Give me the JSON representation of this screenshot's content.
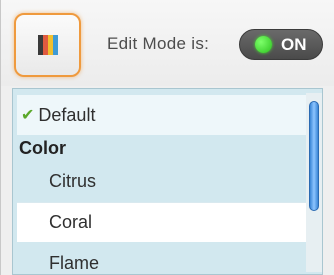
{
  "toolbar": {
    "theme_button_icon": "palette-swatch-icon",
    "edit_mode_label": "Edit Mode is:",
    "toggle_state": "ON",
    "accent_color": "#ef9a3e",
    "toggle_dot_color": "#2cc21e"
  },
  "menu": {
    "default_item": "Default",
    "group_color": "Color",
    "items": [
      {
        "label": "Citrus"
      },
      {
        "label": "Coral"
      },
      {
        "label": "Flame"
      }
    ]
  }
}
